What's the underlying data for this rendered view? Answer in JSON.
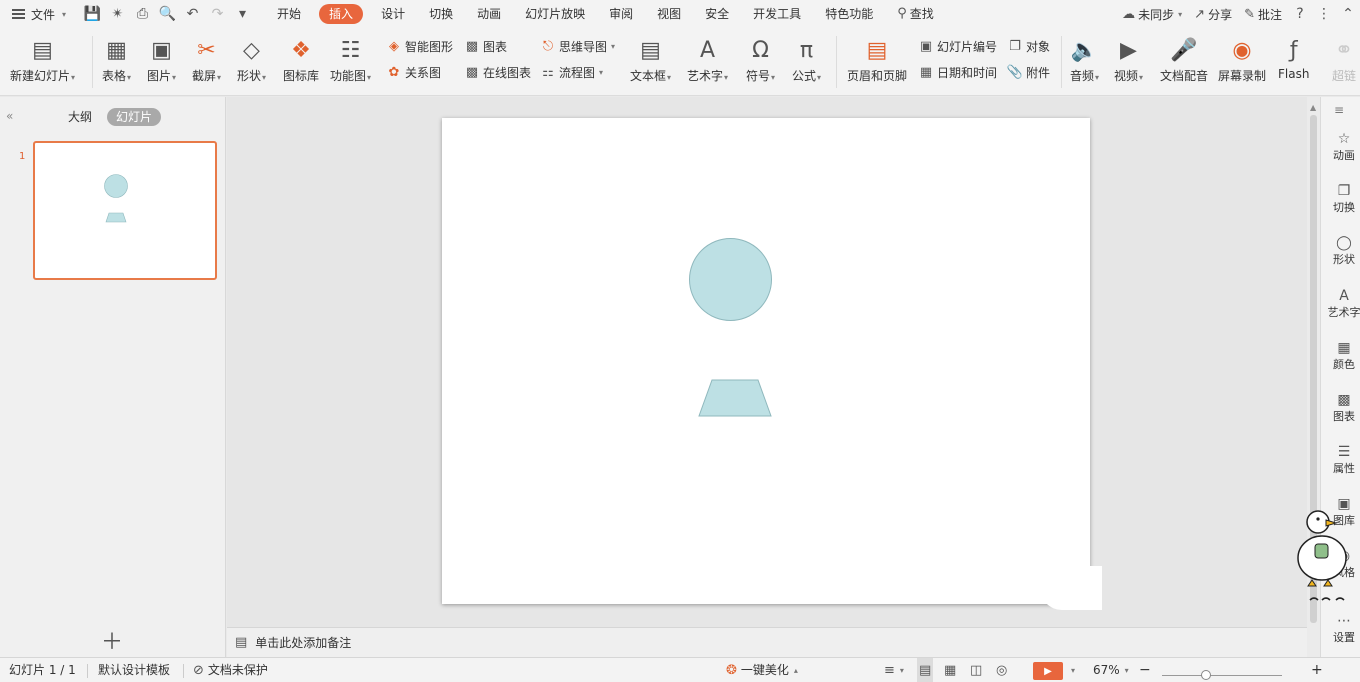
{
  "menubar": {
    "file_label": "文件",
    "tabs": [
      "开始",
      "插入",
      "设计",
      "切换",
      "动画",
      "幻灯片放映",
      "审阅",
      "视图",
      "安全",
      "开发工具",
      "特色功能"
    ],
    "active_tab": "插入",
    "search_label": "查找",
    "sync_label": "未同步",
    "share_label": "分享",
    "comment_label": "批注"
  },
  "ribbon": {
    "new_slide": "新建幻灯片",
    "table": "表格",
    "picture": "图片",
    "screenshot": "截屏",
    "shape": "形状",
    "icon_library": "图标库",
    "function_chart": "功能图",
    "smart_art": "智能图形",
    "chart": "图表",
    "relation": "关系图",
    "online_chart": "在线图表",
    "mind_map": "思维导图",
    "flow_chart": "流程图",
    "text_box": "文本框",
    "word_art": "艺术字",
    "symbol": "符号",
    "formula": "公式",
    "header_footer": "页眉和页脚",
    "slide_number": "幻灯片编号",
    "date_time": "日期和时间",
    "object": "对象",
    "attachment": "附件",
    "audio": "音频",
    "video": "视频",
    "doc_dub": "文档配音",
    "screen_record": "屏幕录制",
    "flash": "Flash",
    "hyperlink": "超链"
  },
  "left_panel": {
    "outline_tab": "大纲",
    "slides_tab": "幻灯片",
    "slide_number": "1"
  },
  "notes": {
    "placeholder": "单击此处添加备注"
  },
  "shape_fill": "#bde0e4",
  "shape_stroke": "#8fb8bd",
  "right_sidebar": {
    "items": [
      "动画",
      "切换",
      "形状",
      "艺术字",
      "颜色",
      "图表",
      "属性",
      "图库",
      "风格",
      "设置"
    ]
  },
  "statusbar": {
    "slide_indicator": "幻灯片 1 / 1",
    "template": "默认设计模板",
    "protection": "文档未保护",
    "beautify": "一键美化",
    "zoom": "67%"
  }
}
